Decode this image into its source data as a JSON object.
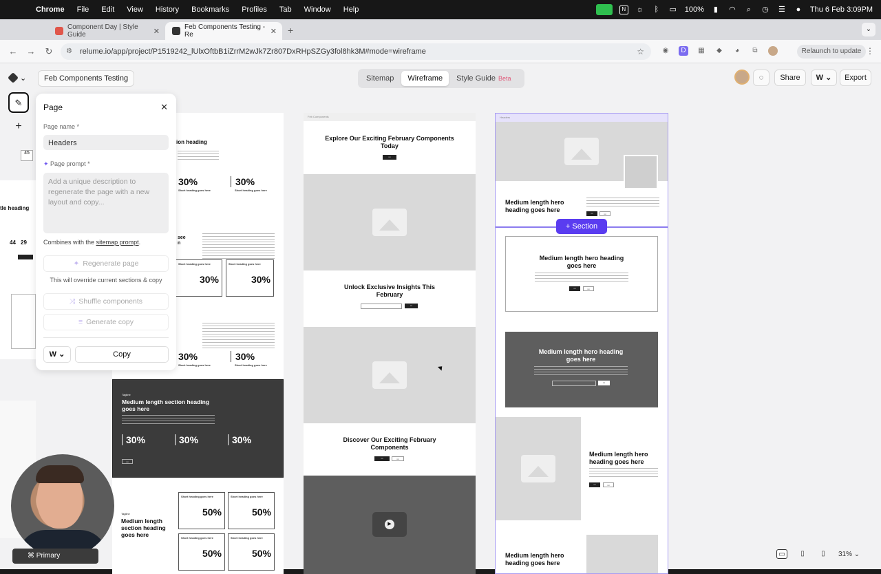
{
  "macos": {
    "app": "Chrome",
    "menus": [
      "File",
      "Edit",
      "View",
      "History",
      "Bookmarks",
      "Profiles",
      "Tab",
      "Window",
      "Help"
    ],
    "battery": "100%",
    "clock": "Thu 6 Feb  3:09PM"
  },
  "browser": {
    "tabs": [
      {
        "title": "Component Day | Style Guide"
      },
      {
        "title": "Feb Components Testing - Re"
      }
    ],
    "url": "relume.io/app/project/P1519242_lUlxOftbB1iZrrM2wJk7Zr807DxRHpSZGy3fol8hk3M#mode=wireframe",
    "relaunch": "Relaunch to update"
  },
  "topbar": {
    "project": "Feb Components Testing",
    "modes": [
      "Sitemap",
      "Wireframe",
      "Style Guide"
    ],
    "active_mode": "Wireframe",
    "beta": "Beta",
    "share": "Share",
    "export": "Export"
  },
  "panel": {
    "title": "Page",
    "page_name_label": "Page name *",
    "page_name": "Headers",
    "prompt_label": "Page prompt *",
    "prompt_placeholder": "Add a unique description to regenerate the page with a new layout and copy...",
    "combines": "Combines with the",
    "sitemap_prompt": "sitemap prompt",
    "regenerate": "Regenerate page",
    "override_note": "This will override current sections & copy",
    "shuffle": "Shuffle components",
    "generate_copy": "Generate copy",
    "copy": "Copy"
  },
  "canvas": {
    "col1": {
      "section_heading": "Medium length section heading goes here",
      "stat30": "30%",
      "stat50": "50%",
      "short_heading": "Short heading goes here",
      "tagline": "Tagline",
      "fragments": {
        "heading_suffix": "ion heading",
        "see": "see",
        "n": "n"
      }
    },
    "col2": {
      "header": "Feb Components",
      "h1": "Explore Our Exciting February Components Today",
      "h2": "Unlock Exclusive Insights This February",
      "h3": "Discover Our Exciting February Components"
    },
    "col3": {
      "header": "Headers",
      "hero1": "Medium length hero heading goes here",
      "hero2": "Medium length hero heading goes here",
      "hero3": "Medium length hero heading goes here",
      "hero4": "Medium length hero heading goes here",
      "hero5": "Medium length hero heading goes here",
      "section_btn": "Section"
    },
    "mini": {
      "stat": "45",
      "nums": [
        "44",
        "29"
      ],
      "heading": "tle heading",
      "event_title": "Event title heading",
      "footer_heading": "tle heading"
    }
  },
  "bottom": {
    "primary": "Primary",
    "zoom": "31%"
  }
}
